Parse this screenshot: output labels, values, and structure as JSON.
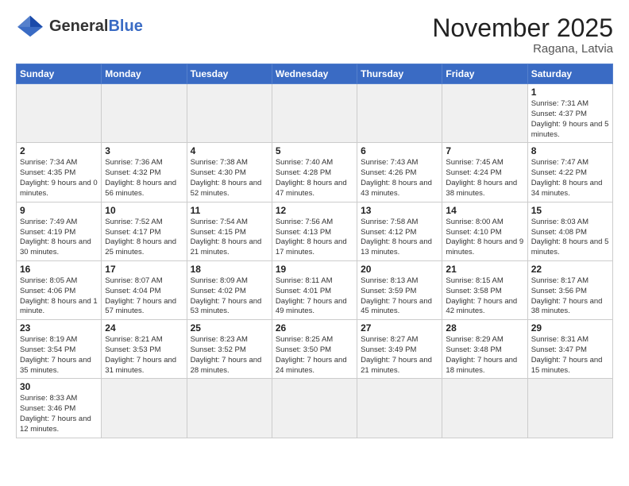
{
  "header": {
    "logo_general": "General",
    "logo_blue": "Blue",
    "month_title": "November 2025",
    "subtitle": "Ragana, Latvia"
  },
  "weekdays": [
    "Sunday",
    "Monday",
    "Tuesday",
    "Wednesday",
    "Thursday",
    "Friday",
    "Saturday"
  ],
  "weeks": [
    [
      {
        "day": "",
        "info": "",
        "empty": true
      },
      {
        "day": "",
        "info": "",
        "empty": true
      },
      {
        "day": "",
        "info": "",
        "empty": true
      },
      {
        "day": "",
        "info": "",
        "empty": true
      },
      {
        "day": "",
        "info": "",
        "empty": true
      },
      {
        "day": "",
        "info": "",
        "empty": true
      },
      {
        "day": "1",
        "info": "Sunrise: 7:31 AM\nSunset: 4:37 PM\nDaylight: 9 hours\nand 5 minutes.",
        "empty": false
      }
    ],
    [
      {
        "day": "2",
        "info": "Sunrise: 7:34 AM\nSunset: 4:35 PM\nDaylight: 9 hours\nand 0 minutes.",
        "empty": false
      },
      {
        "day": "3",
        "info": "Sunrise: 7:36 AM\nSunset: 4:32 PM\nDaylight: 8 hours\nand 56 minutes.",
        "empty": false
      },
      {
        "day": "4",
        "info": "Sunrise: 7:38 AM\nSunset: 4:30 PM\nDaylight: 8 hours\nand 52 minutes.",
        "empty": false
      },
      {
        "day": "5",
        "info": "Sunrise: 7:40 AM\nSunset: 4:28 PM\nDaylight: 8 hours\nand 47 minutes.",
        "empty": false
      },
      {
        "day": "6",
        "info": "Sunrise: 7:43 AM\nSunset: 4:26 PM\nDaylight: 8 hours\nand 43 minutes.",
        "empty": false
      },
      {
        "day": "7",
        "info": "Sunrise: 7:45 AM\nSunset: 4:24 PM\nDaylight: 8 hours\nand 38 minutes.",
        "empty": false
      },
      {
        "day": "8",
        "info": "Sunrise: 7:47 AM\nSunset: 4:22 PM\nDaylight: 8 hours\nand 34 minutes.",
        "empty": false
      }
    ],
    [
      {
        "day": "9",
        "info": "Sunrise: 7:49 AM\nSunset: 4:19 PM\nDaylight: 8 hours\nand 30 minutes.",
        "empty": false
      },
      {
        "day": "10",
        "info": "Sunrise: 7:52 AM\nSunset: 4:17 PM\nDaylight: 8 hours\nand 25 minutes.",
        "empty": false
      },
      {
        "day": "11",
        "info": "Sunrise: 7:54 AM\nSunset: 4:15 PM\nDaylight: 8 hours\nand 21 minutes.",
        "empty": false
      },
      {
        "day": "12",
        "info": "Sunrise: 7:56 AM\nSunset: 4:13 PM\nDaylight: 8 hours\nand 17 minutes.",
        "empty": false
      },
      {
        "day": "13",
        "info": "Sunrise: 7:58 AM\nSunset: 4:12 PM\nDaylight: 8 hours\nand 13 minutes.",
        "empty": false
      },
      {
        "day": "14",
        "info": "Sunrise: 8:00 AM\nSunset: 4:10 PM\nDaylight: 8 hours\nand 9 minutes.",
        "empty": false
      },
      {
        "day": "15",
        "info": "Sunrise: 8:03 AM\nSunset: 4:08 PM\nDaylight: 8 hours\nand 5 minutes.",
        "empty": false
      }
    ],
    [
      {
        "day": "16",
        "info": "Sunrise: 8:05 AM\nSunset: 4:06 PM\nDaylight: 8 hours\nand 1 minute.",
        "empty": false
      },
      {
        "day": "17",
        "info": "Sunrise: 8:07 AM\nSunset: 4:04 PM\nDaylight: 7 hours\nand 57 minutes.",
        "empty": false
      },
      {
        "day": "18",
        "info": "Sunrise: 8:09 AM\nSunset: 4:02 PM\nDaylight: 7 hours\nand 53 minutes.",
        "empty": false
      },
      {
        "day": "19",
        "info": "Sunrise: 8:11 AM\nSunset: 4:01 PM\nDaylight: 7 hours\nand 49 minutes.",
        "empty": false
      },
      {
        "day": "20",
        "info": "Sunrise: 8:13 AM\nSunset: 3:59 PM\nDaylight: 7 hours\nand 45 minutes.",
        "empty": false
      },
      {
        "day": "21",
        "info": "Sunrise: 8:15 AM\nSunset: 3:58 PM\nDaylight: 7 hours\nand 42 minutes.",
        "empty": false
      },
      {
        "day": "22",
        "info": "Sunrise: 8:17 AM\nSunset: 3:56 PM\nDaylight: 7 hours\nand 38 minutes.",
        "empty": false
      }
    ],
    [
      {
        "day": "23",
        "info": "Sunrise: 8:19 AM\nSunset: 3:54 PM\nDaylight: 7 hours\nand 35 minutes.",
        "empty": false
      },
      {
        "day": "24",
        "info": "Sunrise: 8:21 AM\nSunset: 3:53 PM\nDaylight: 7 hours\nand 31 minutes.",
        "empty": false
      },
      {
        "day": "25",
        "info": "Sunrise: 8:23 AM\nSunset: 3:52 PM\nDaylight: 7 hours\nand 28 minutes.",
        "empty": false
      },
      {
        "day": "26",
        "info": "Sunrise: 8:25 AM\nSunset: 3:50 PM\nDaylight: 7 hours\nand 24 minutes.",
        "empty": false
      },
      {
        "day": "27",
        "info": "Sunrise: 8:27 AM\nSunset: 3:49 PM\nDaylight: 7 hours\nand 21 minutes.",
        "empty": false
      },
      {
        "day": "28",
        "info": "Sunrise: 8:29 AM\nSunset: 3:48 PM\nDaylight: 7 hours\nand 18 minutes.",
        "empty": false
      },
      {
        "day": "29",
        "info": "Sunrise: 8:31 AM\nSunset: 3:47 PM\nDaylight: 7 hours\nand 15 minutes.",
        "empty": false
      }
    ],
    [
      {
        "day": "30",
        "info": "Sunrise: 8:33 AM\nSunset: 3:46 PM\nDaylight: 7 hours\nand 12 minutes.",
        "empty": false
      },
      {
        "day": "",
        "info": "",
        "empty": true
      },
      {
        "day": "",
        "info": "",
        "empty": true
      },
      {
        "day": "",
        "info": "",
        "empty": true
      },
      {
        "day": "",
        "info": "",
        "empty": true
      },
      {
        "day": "",
        "info": "",
        "empty": true
      },
      {
        "day": "",
        "info": "",
        "empty": true
      }
    ]
  ]
}
